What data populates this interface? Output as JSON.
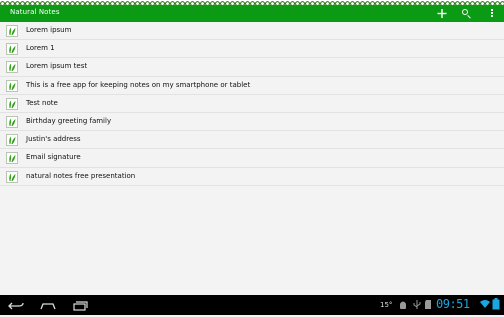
{
  "app": {
    "title": "Natural Notes"
  },
  "actions": {
    "add_icon": "plus-icon",
    "search_icon": "search-icon",
    "overflow_icon": "overflow-menu-icon"
  },
  "notes": [
    "Lorem ipsum",
    "Lorem 1",
    "Lorem ipsum test",
    "This is a free app for keeping notes on my smartphone or tablet",
    "Test note",
    "Birthday greeting family",
    "Justin's address",
    "Email signature",
    "natural notes free presentation"
  ],
  "status_bar": {
    "temperature": "15°",
    "time": "09:51"
  },
  "colors": {
    "actionbar": "#0a9a14",
    "clock": "#1aa6e0",
    "leaf": "#2e9e1a"
  }
}
